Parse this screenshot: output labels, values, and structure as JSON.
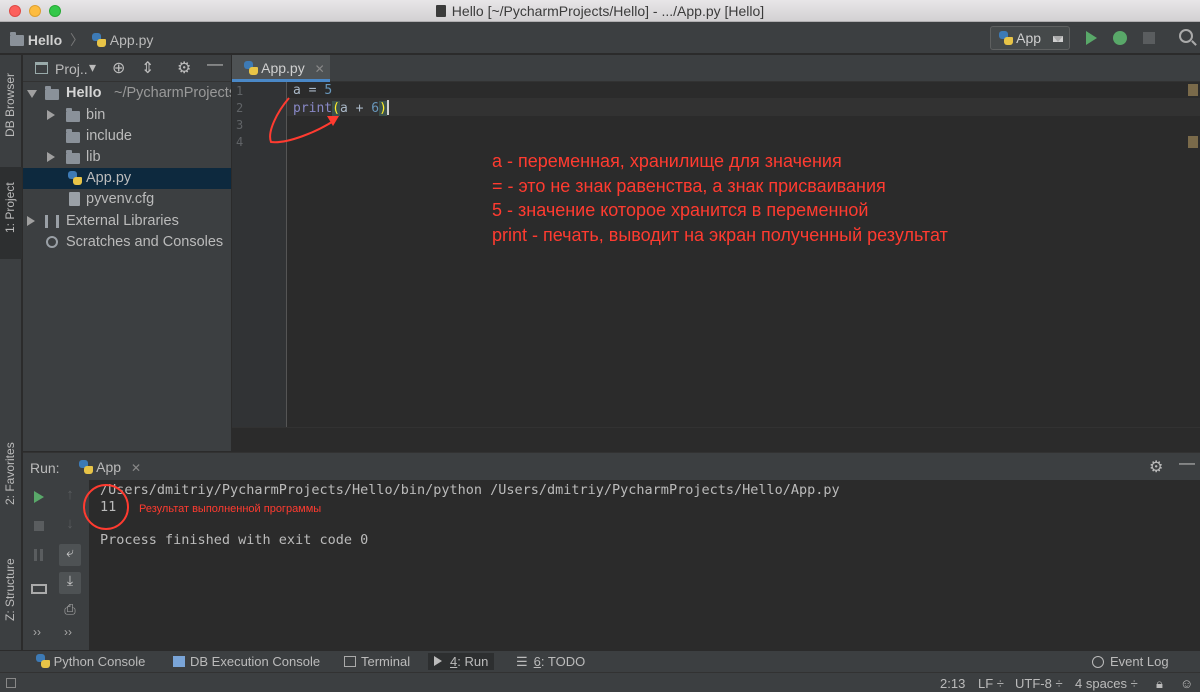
{
  "window": {
    "title": "Hello [~/PycharmProjects/Hello] - .../App.py [Hello]"
  },
  "navbar": {
    "project": "Hello",
    "file": "App.py",
    "run_config": "App"
  },
  "left_strip": {
    "db_browser": "DB Browser",
    "project": "1: Project",
    "favorites": "2: Favorites",
    "structure": "Z: Structure"
  },
  "project_panel": {
    "header_label": "Proj..",
    "tree": [
      {
        "label": "Hello",
        "path": "~/PycharmProjects/Hello",
        "type": "root"
      },
      {
        "label": "bin",
        "type": "folder"
      },
      {
        "label": "include",
        "type": "folder"
      },
      {
        "label": "lib",
        "type": "folder"
      },
      {
        "label": "App.py",
        "type": "python-file"
      },
      {
        "label": "pyvenv.cfg",
        "type": "file"
      },
      {
        "label": "External Libraries",
        "type": "library"
      },
      {
        "label": "Scratches and Consoles",
        "type": "scratches"
      }
    ]
  },
  "editor": {
    "tab_label": "App.py",
    "line_numbers": [
      "1",
      "2",
      "3",
      "4"
    ],
    "code": {
      "line1": "a = 5",
      "line2_kw": "print",
      "line2_open": "(",
      "line2_mid": "a + ",
      "line2_num": "6",
      "line2_close": ")",
      "line1_var": "a = ",
      "line1_num": "5"
    },
    "annotations": [
      "a - переменная, хранилище для значения",
      "= - это не знак равенства, а знак присваивания",
      "5 - значение которое хранится в переменной",
      "print - печать, выводит на экран полученный результат"
    ]
  },
  "run_panel": {
    "label": "Run:",
    "tab": "App",
    "output": [
      "/Users/dmitriy/PycharmProjects/Hello/bin/python /Users/dmitriy/PycharmProjects/Hello/App.py",
      "11",
      "",
      "Process finished with exit code 0"
    ],
    "result_note": "Результат выполненной программы"
  },
  "bottom_tools": {
    "python_console": "Python Console",
    "db_execution_console": "DB Execution Console",
    "terminal": "Terminal",
    "run_num": "4",
    "run_label": ": Run",
    "todo_num": "6",
    "todo_label": ": TODO",
    "event_log": "Event Log"
  },
  "statusbar": {
    "position": "2:13",
    "line_separator": "LF",
    "encoding": "UTF-8",
    "indent": "4 spaces"
  },
  "colors": {
    "accent": "#4a88c7",
    "annotation": "#ff3b30",
    "run_green": "#59a869"
  }
}
